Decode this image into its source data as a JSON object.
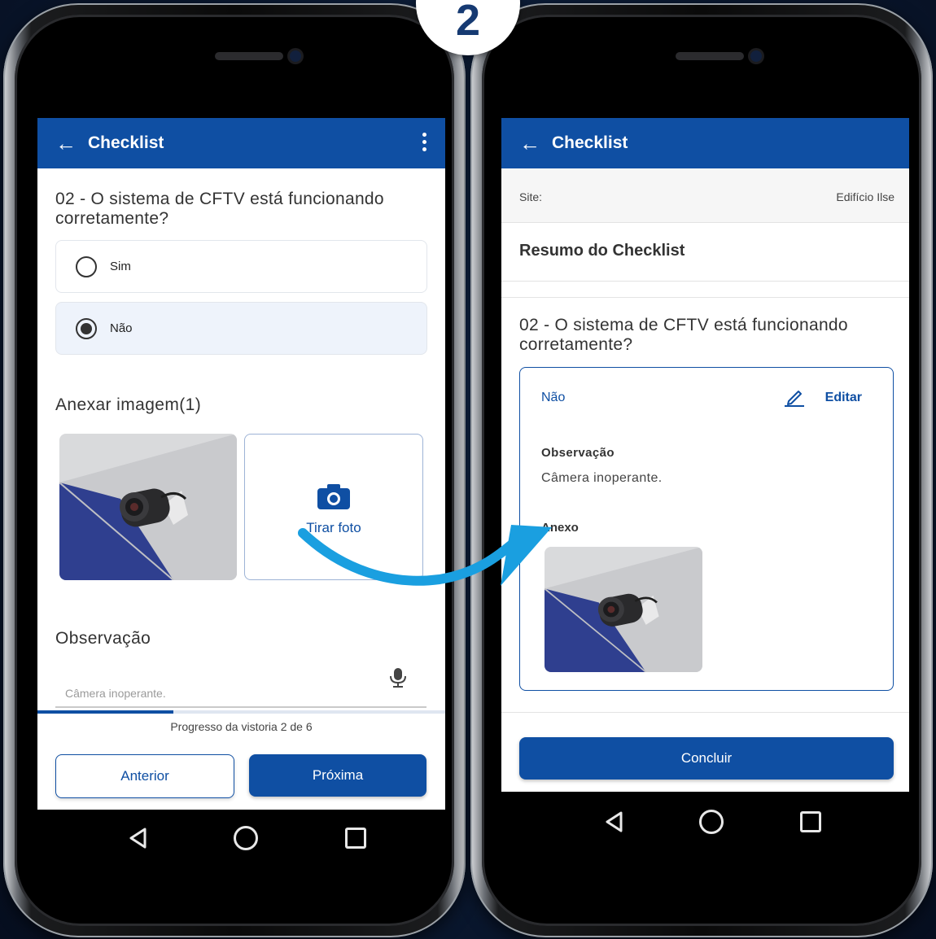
{
  "step_badge": "2",
  "left_screen": {
    "app_title": "Checklist",
    "question": "02 - O sistema de CFTV está funcionando corretamente?",
    "options": [
      {
        "label": "Sim",
        "selected": false
      },
      {
        "label": "Não",
        "selected": true
      }
    ],
    "attach_heading": "Anexar imagem(1)",
    "take_photo_label": "Tirar foto",
    "observation_heading": "Observação",
    "observation_value": "Câmera inoperante.",
    "progress_text": "Progresso da vistoria 2 de 6",
    "progress_fraction": 0.333,
    "prev_button": "Anterior",
    "next_button": "Próxima"
  },
  "right_screen": {
    "app_title": "Checklist",
    "site_label": "Site:",
    "site_value": "Edifício Ilse",
    "summary_heading": "Resumo do Checklist",
    "question": "02 - O sistema de CFTV está funcionando corretamente?",
    "answer": "Não",
    "edit_label": "Editar",
    "observation_heading": "Observação",
    "observation_value": "Câmera inoperante.",
    "attachment_heading": "Anexo",
    "conclude_button": "Concluir"
  },
  "colors": {
    "primary": "#0f4fa3",
    "arrow": "#1a9fe0"
  }
}
